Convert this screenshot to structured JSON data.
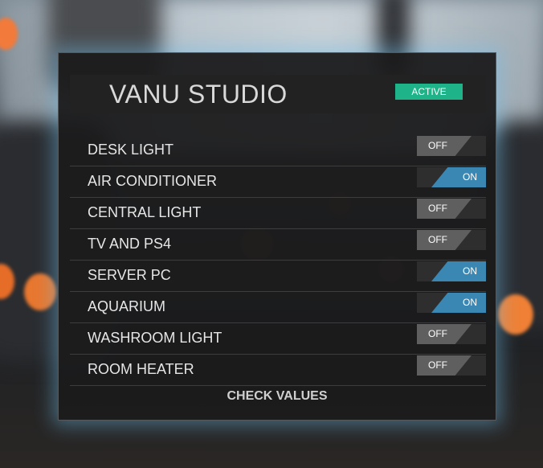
{
  "panel": {
    "title": "VANU STUDIO",
    "status_badge": "ACTIVE",
    "badge_color": "#1fb389",
    "on_color": "#3a87b3",
    "off_color": "#5f5f60"
  },
  "devices": [
    {
      "label": "DESK LIGHT",
      "state": "OFF"
    },
    {
      "label": "AIR CONDITIONER",
      "state": "ON"
    },
    {
      "label": "CENTRAL LIGHT",
      "state": "OFF"
    },
    {
      "label": "TV AND PS4",
      "state": "OFF"
    },
    {
      "label": "SERVER PC",
      "state": "ON"
    },
    {
      "label": "AQUARIUM",
      "state": "ON"
    },
    {
      "label": "WASHROOM LIGHT",
      "state": "OFF"
    },
    {
      "label": "ROOM HEATER",
      "state": "OFF"
    }
  ],
  "actions": {
    "check_label": "CHECK VALUES"
  }
}
